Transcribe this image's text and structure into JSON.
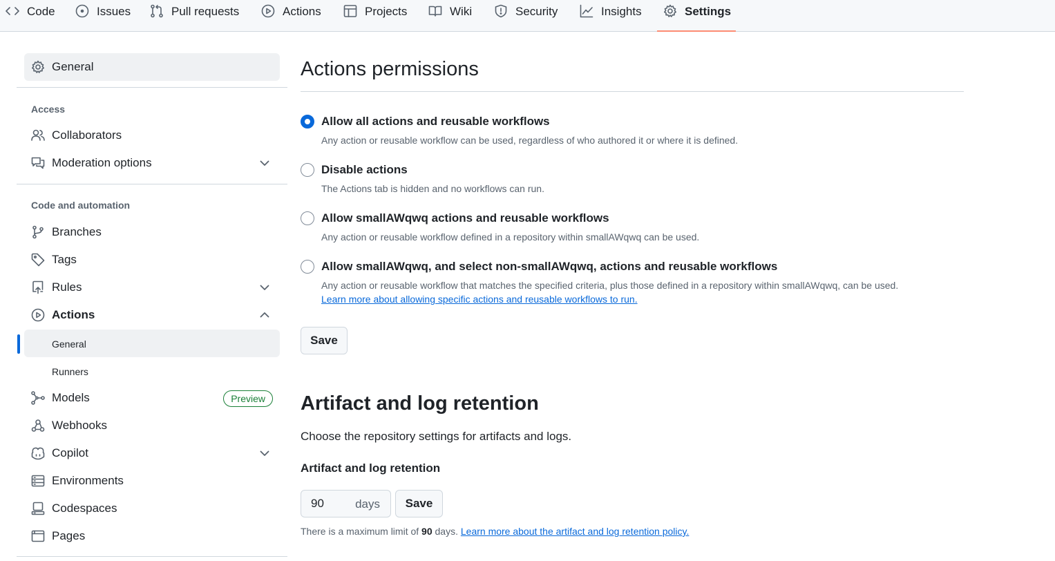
{
  "nav": {
    "tabs": [
      {
        "label": "Code",
        "icon": "code-icon"
      },
      {
        "label": "Issues",
        "icon": "issue-opened-icon"
      },
      {
        "label": "Pull requests",
        "icon": "git-pull-request-icon"
      },
      {
        "label": "Actions",
        "icon": "play-icon"
      },
      {
        "label": "Projects",
        "icon": "table-icon"
      },
      {
        "label": "Wiki",
        "icon": "book-icon"
      },
      {
        "label": "Security",
        "icon": "shield-icon"
      },
      {
        "label": "Insights",
        "icon": "graph-icon"
      },
      {
        "label": "Settings",
        "icon": "gear-icon",
        "active": true
      }
    ]
  },
  "sidebar": {
    "general": "General",
    "access_heading": "Access",
    "collaborators": "Collaborators",
    "moderation": "Moderation options",
    "code_heading": "Code and automation",
    "branches": "Branches",
    "tags": "Tags",
    "rules": "Rules",
    "actions": "Actions",
    "actions_general": "General",
    "actions_runners": "Runners",
    "models": "Models",
    "models_badge": "Preview",
    "webhooks": "Webhooks",
    "copilot": "Copilot",
    "environments": "Environments",
    "codespaces": "Codespaces",
    "pages": "Pages"
  },
  "permissions": {
    "title": "Actions permissions",
    "options": [
      {
        "label": "Allow all actions and reusable workflows",
        "desc": "Any action or reusable workflow can be used, regardless of who authored it or where it is defined.",
        "checked": true
      },
      {
        "label": "Disable actions",
        "desc": "The Actions tab is hidden and no workflows can run.",
        "checked": false
      },
      {
        "label": "Allow smallAWqwq actions and reusable workflows",
        "desc": "Any action or reusable workflow defined in a repository within smallAWqwq can be used.",
        "checked": false
      },
      {
        "label": "Allow smallAWqwq, and select non-smallAWqwq, actions and reusable workflows",
        "desc": "Any action or reusable workflow that matches the specified criteria, plus those defined in a repository within smallAWqwq, can be used.",
        "link": "Learn more about allowing specific actions and reusable workflows to run.",
        "checked": false
      }
    ],
    "save_label": "Save"
  },
  "retention": {
    "title": "Artifact and log retention",
    "description": "Choose the repository settings for artifacts and logs.",
    "field_label": "Artifact and log retention",
    "days_value": "90",
    "days_unit": "days",
    "save_label": "Save",
    "note_prefix": "There is a maximum limit of",
    "note_limit": "90",
    "note_suffix": "days.",
    "note_link": "Learn more about the artifact and log retention policy."
  }
}
